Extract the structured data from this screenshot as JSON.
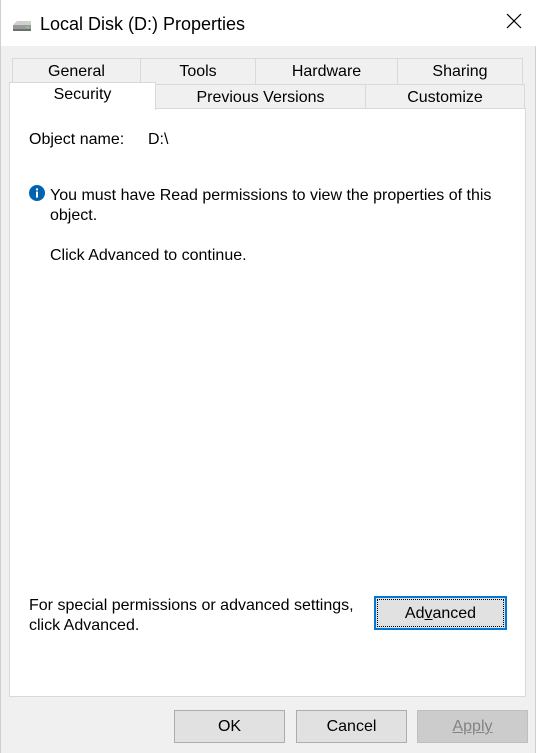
{
  "window": {
    "title": "Local Disk (D:) Properties"
  },
  "tabs": {
    "row1": [
      "General",
      "Tools",
      "Hardware",
      "Sharing"
    ],
    "row2": [
      "Security",
      "Previous Versions",
      "Customize"
    ],
    "active": "Security"
  },
  "security": {
    "object_name_label": "Object name:",
    "object_name_value": "D:\\",
    "info_message": "You must have Read permissions to view the properties of this object.",
    "continue_message": "Click Advanced to continue.",
    "special_message": "For special permissions or advanced settings, click Advanced.",
    "advanced_button": {
      "pre": "Ad",
      "accel": "v",
      "post": "anced"
    }
  },
  "footer": {
    "ok_label": "OK",
    "cancel_label": "Cancel",
    "apply_label": "Apply",
    "apply_enabled": false
  },
  "colors": {
    "focus_border": "#0078d7",
    "info_icon": "#0063b1"
  },
  "icons": {
    "title": "drive-icon",
    "close": "close-icon",
    "info": "info-icon"
  }
}
